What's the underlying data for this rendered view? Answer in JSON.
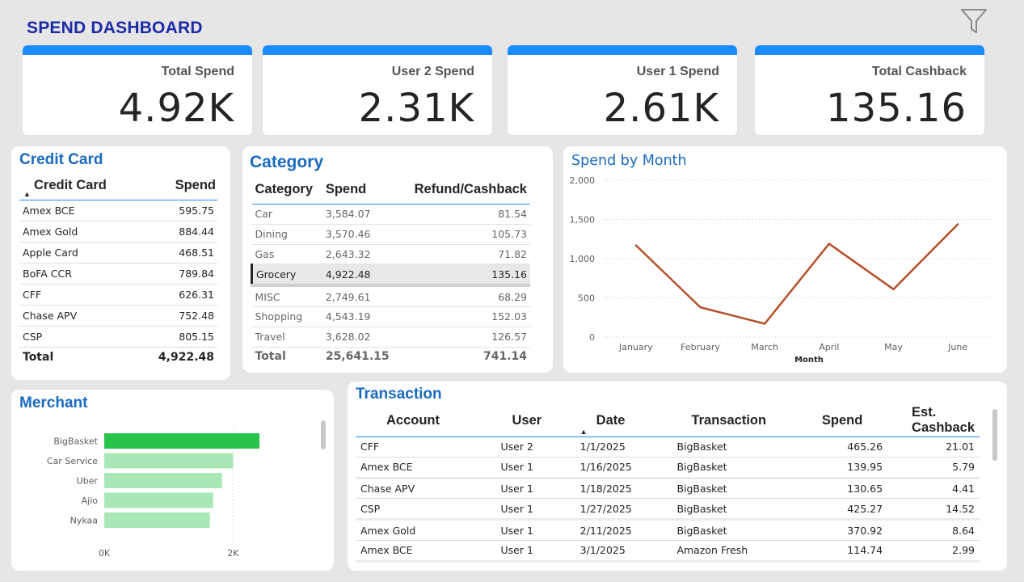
{
  "header": {
    "title": "SPEND DASHBOARD"
  },
  "icons": {
    "filter": "filter-icon",
    "sort": "sort-ascending-icon"
  },
  "colors": {
    "accent": "#1a8cff",
    "title": "#1b2aa6",
    "card_title": "#1a6bbf",
    "line": "#b5502a",
    "merchant_top": "#27c34a",
    "merchant_bar": "#a8e8b6"
  },
  "kpis": [
    {
      "label": "Total Spend",
      "value": "4.92K"
    },
    {
      "label": "User 2 Spend",
      "value": "2.31K"
    },
    {
      "label": "User 1 Spend",
      "value": "2.61K"
    },
    {
      "label": "Total Cashback",
      "value": "135.16"
    }
  ],
  "credit_card": {
    "title": "Credit Card",
    "headers": [
      "Credit Card",
      "Spend"
    ],
    "rows": [
      {
        "name": "Amex BCE",
        "spend": "595.75"
      },
      {
        "name": "Amex Gold",
        "spend": "884.44"
      },
      {
        "name": "Apple Card",
        "spend": "468.51"
      },
      {
        "name": "BoFA CCR",
        "spend": "789.84"
      },
      {
        "name": "CFF",
        "spend": "626.31"
      },
      {
        "name": "Chase APV",
        "spend": "752.48"
      },
      {
        "name": "CSP",
        "spend": "805.15"
      }
    ],
    "total_label": "Total",
    "total_value": "4,922.48"
  },
  "category": {
    "title": "Category",
    "headers": [
      "Category",
      "Spend",
      "Refund/Cashback"
    ],
    "rows": [
      {
        "name": "Car",
        "spend": "3,584.07",
        "cashback": "81.54"
      },
      {
        "name": "Dining",
        "spend": "3,570.46",
        "cashback": "105.73"
      },
      {
        "name": "Gas",
        "spend": "2,643.32",
        "cashback": "71.82"
      },
      {
        "name": "Grocery",
        "spend": "4,922.48",
        "cashback": "135.16"
      },
      {
        "name": "MISC",
        "spend": "2,749.61",
        "cashback": "68.29"
      },
      {
        "name": "Shopping",
        "spend": "4,543.19",
        "cashback": "152.03"
      },
      {
        "name": "Travel",
        "spend": "3,628.02",
        "cashback": "126.57"
      }
    ],
    "selected_index": 3,
    "total_label": "Total",
    "total_spend": "25,641.15",
    "total_cashback": "741.14"
  },
  "spend_by_month": {
    "title": "Spend by Month",
    "chart_data": {
      "type": "line",
      "title": "Spend by Month",
      "xlabel": "Month",
      "ylabel": "",
      "categories": [
        "January",
        "February",
        "March",
        "April",
        "May",
        "June"
      ],
      "values": [
        1170,
        380,
        170,
        1190,
        610,
        1440
      ],
      "ylim": [
        0,
        2000
      ],
      "yticks": [
        "0",
        "500",
        "1,000",
        "1,500",
        "2,000"
      ],
      "grid": true
    }
  },
  "merchant": {
    "title": "Merchant",
    "chart_data": {
      "type": "bar",
      "orientation": "horizontal",
      "title": "Merchant",
      "categories": [
        "BigBasket",
        "Car Service",
        "Uber",
        "Ajio",
        "Nykaa"
      ],
      "values": [
        2410,
        2000,
        1830,
        1690,
        1640
      ],
      "xlim": [
        0,
        3100
      ],
      "xticks": [
        "0K",
        "2K"
      ]
    }
  },
  "transaction": {
    "title": "Transaction",
    "headers": [
      "Account",
      "User",
      "Date",
      "Transaction",
      "Spend",
      "Est. Cashback"
    ],
    "rows": [
      {
        "account": "CFF",
        "user": "User 2",
        "date": "1/1/2025",
        "transaction": "BigBasket",
        "spend": "465.26",
        "cashback": "21.01"
      },
      {
        "account": "Amex BCE",
        "user": "User 1",
        "date": "1/16/2025",
        "transaction": "BigBasket",
        "spend": "139.95",
        "cashback": "5.79"
      },
      {
        "account": "Chase APV",
        "user": "User 1",
        "date": "1/18/2025",
        "transaction": "BigBasket",
        "spend": "130.65",
        "cashback": "4.41"
      },
      {
        "account": "CSP",
        "user": "User 1",
        "date": "1/27/2025",
        "transaction": "BigBasket",
        "spend": "425.27",
        "cashback": "14.52"
      },
      {
        "account": "Amex Gold",
        "user": "User 1",
        "date": "2/11/2025",
        "transaction": "BigBasket",
        "spend": "370.92",
        "cashback": "8.64"
      },
      {
        "account": "Amex BCE",
        "user": "User 1",
        "date": "3/1/2025",
        "transaction": "Amazon Fresh",
        "spend": "114.74",
        "cashback": "2.99"
      }
    ]
  }
}
